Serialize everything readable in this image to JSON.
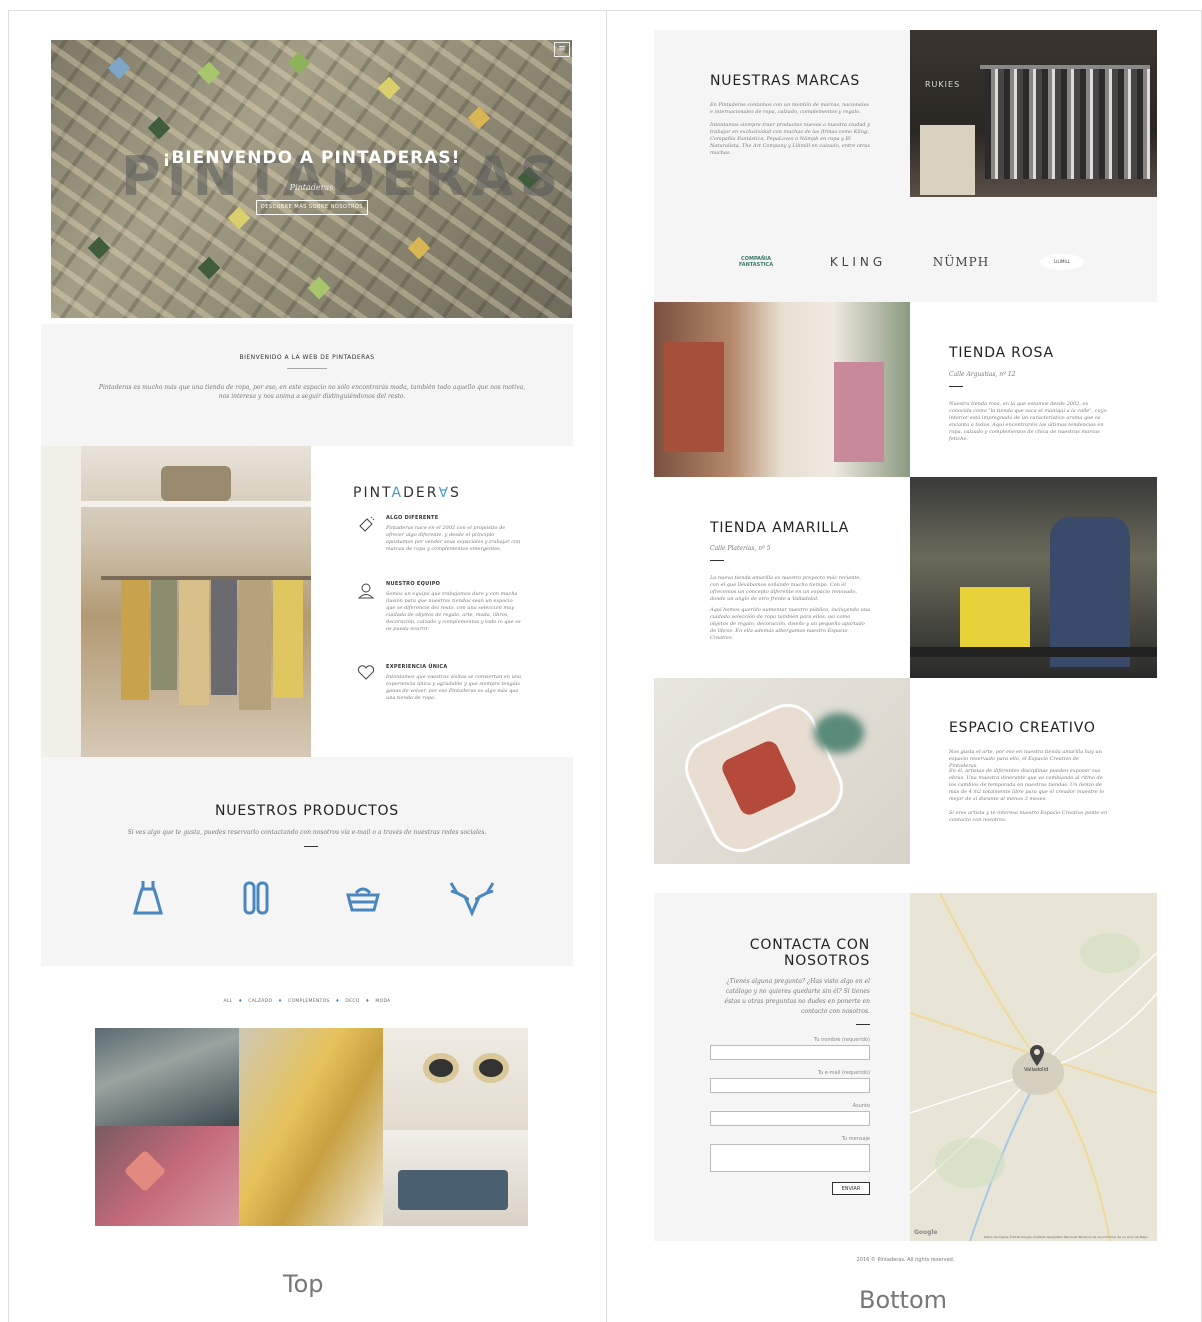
{
  "hero": {
    "ghost_word": "PINTADERAS",
    "title": "¡BIENVENDO A PINTADERAS!",
    "subtitle": "Pintaderas",
    "cta": "DESCUBRE MÁS SOBRE NOSOTROS",
    "menu_icon": "≡"
  },
  "welcome": {
    "heading": "BIENVENIDO A LA WEB DE PINTADERAS",
    "text": "Pintaderas es mucho más que una tienda de ropa, por eso, en este espacio no sólo encontrarás moda, también todo aquello que nos motiva, nos interesa y nos anima a seguir distinguiéndonos del resto."
  },
  "about": {
    "brand_a": "PINT",
    "brand_b": "A",
    "brand_c": "DER",
    "brand_d": "∀",
    "brand_e": "S",
    "features": [
      {
        "title": "ALGO DIFERENTE",
        "text": "Pintaderas nace en el 2002 con el propósito de ofrecer algo diferente, y desde el principio apostamos por vender sous espaciales y trabajar con marcas de ropa y complementos emergentes.",
        "icon": "sparkle-icon"
      },
      {
        "title": "NUESTRO EQUIPO",
        "text": "Somos un equipo que trabajamos duro y con mucha ilusión para que nuestras tiendas sean un espacio que se diferencie del resto, con una selección muy cuidada de objetos de regalo, arte, moda, libros, decoración, calzado y complementos y todo lo que se os pueda ocurrir.",
        "icon": "person-icon"
      },
      {
        "title": "EXPERIENCIA ÚNICA",
        "text": "Intentamos que vuestras visitas se conviertan en una experiencia única y agradable y que siempre tengáis ganas de volver, por eso Pintaderas es algo más que una tienda de ropa.",
        "icon": "heart-icon"
      }
    ]
  },
  "products": {
    "heading": "NUESTROS PRODUCTOS",
    "text": "Si ves algo que te gusta, puedes reservarlo contactando con nosotros vía e-mail o a través de nuestras redes sociales.",
    "icons": [
      "dress-icon",
      "shoes-icon",
      "basket-icon",
      "deer-icon"
    ],
    "filters": [
      "ALL",
      "CALZADO",
      "COMPLEMENTOS",
      "DECO",
      "MODA"
    ],
    "filter_sep": "♦"
  },
  "brands": {
    "heading": "NUESTRAS MARCAS",
    "text1": "En Pintaderas contamos con un montón de marcas, nacionales e internacionales de ropa, calzado, complementos y regalo.",
    "text2": "Intentamos siempre traer productos nuevos a nuestra ciudad y trabajar en exclusividad con muchas de las firmas como Kling, Compañía Fantástica, PepaLoves o Nümph en ropa y El Naturalista, The Art Company y Lilimill en calzado, entre otras muchas.",
    "shop_sign": "RUKIES",
    "logos": [
      "COMPAÑIA FANTASTICA",
      "KLING",
      "NÜMPH",
      "LILIMILL"
    ]
  },
  "tienda_rosa": {
    "heading": "TIENDA ROSA",
    "address": "Calle Argustias, nº 12",
    "text": "Nuestra tienda rosa, en la que estamos desde 2002, es conocida como \"la tienda que saca el maniquí a la calle\", cuyo interior está impregnado de un característico aroma que os encanta a todos. Aquí encontraréis las últimas tendencias en ropa, calzado y complementos de chica de nuestras marcas fetiche."
  },
  "tienda_amarilla": {
    "heading": "TIENDA AMARILLA",
    "address": "Calle Platerías, nº 5",
    "text1": "La nueva tienda amarilla es nuestro proyecto más reciente, con el que llevábamos soñando mucho tiempo. Con él ofrecemos un concepto diferente en un espacio renovado, donde un anglo de otro frente a Valladolid.",
    "text2": "Aquí hemos querido aumentar nuestro público, incluyendo una cuidada selección de ropa también para ellos, así como objetos de regalo, decoración, diseño y un pequeño apartado de libros. En ella además albergamos nuestro Espacio Creativo."
  },
  "espacio": {
    "heading": "ESPACIO CREATIVO",
    "text1": "Nos gusta el arte, por eso en nuestra tienda amarilla hay un espacio reservado para ello, el Espacio Creativo de Pintaderas.",
    "text2": "En él, artistas de diferentes disciplinas pueden exponer sus obras. Una muestra itinerante que va cambiando al ritmo de los cambios de temporada en nuestras tiendas. Un lienzo de más de 4 m2 totalmente libre para que el creador muestre lo mejor de sí durante al menos 3 meses.",
    "text3": "Si eres artista y te interesa nuestro Espacio Creativo ponte en contacto con nosotros."
  },
  "contact": {
    "heading1": "CONTACTA CON",
    "heading2": "NOSOTROS",
    "text": "¿Tienes alguna pregunta? ¿Has visto algo en el catálogo y no quieres quedarte sin él? Si tienes éstas u otras preguntas no dudes en ponerte en contacto con nosotros.",
    "fields": [
      "Tu nombre (requerido)",
      "Tu e-mail (requerido)",
      "Asunto",
      "Tu mensaje"
    ],
    "submit": "ENVIAR",
    "map_city": "Valladolid",
    "map_footer": "Datos de mapas ©2016 Google, Instituto Geográfico Nacional   Términos de uso   Informar de un error de Maps",
    "map_brand": "Google"
  },
  "footer": {
    "copyright": "2016 © Pintaderas. All rights reserved."
  },
  "captions": {
    "left": "Top",
    "right": "Bottom"
  },
  "colors": {
    "accent": "#4a86c0",
    "panel": "#f5f5f5",
    "brand_yellow": "#e2b73a",
    "brand_blue": "#4a9ccf"
  }
}
